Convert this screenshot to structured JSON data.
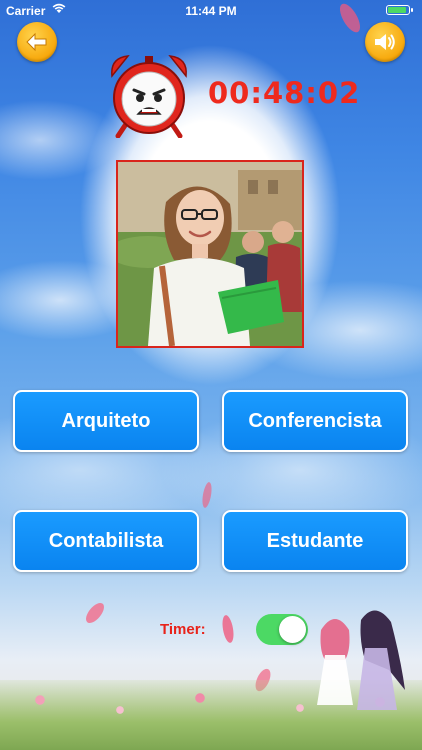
{
  "status_bar": {
    "carrier": "Carrier",
    "time": "11:44 PM",
    "wifi_icon": "wifi-icon",
    "battery_icon": "battery-icon"
  },
  "header": {
    "back_icon": "back-arrow-icon",
    "sound_icon": "speaker-icon",
    "alarm_icon": "alarm-clock-icon",
    "countdown": "00:48:02",
    "countdown_color": "#ee2a1e",
    "button_color": "#f7a70a"
  },
  "question": {
    "image_icon": "person-photo"
  },
  "answers": {
    "options": [
      "Arquiteto",
      "Conferencista",
      "Contabilista",
      "Estudante"
    ],
    "button_color": "#0a84f0"
  },
  "settings": {
    "timer_label": "Timer:",
    "timer_on": true,
    "toggle_color": "#4cd964"
  }
}
